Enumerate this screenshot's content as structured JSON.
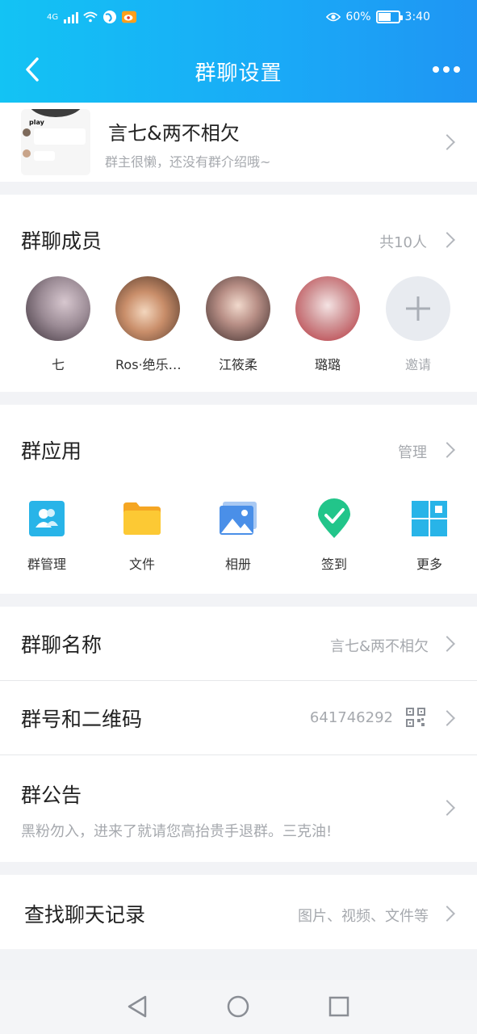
{
  "status_bar": {
    "network_label": "4G",
    "battery": "60%",
    "time": "3:40"
  },
  "nav": {
    "title": "群聊设置"
  },
  "group": {
    "name": "言七&两不相欠",
    "description": "群主很懒，还没有群介绍哦~",
    "thumb_label": "play"
  },
  "members": {
    "title": "群聊成员",
    "count": "共10人",
    "list": [
      {
        "name": "七"
      },
      {
        "name": "Ros·绝乐…"
      },
      {
        "name": "江筱柔"
      },
      {
        "name": "璐璐"
      }
    ],
    "invite_label": "邀请"
  },
  "apps": {
    "title": "群应用",
    "manage": "管理",
    "items": [
      {
        "label": "群管理",
        "icon": "group-manage-icon"
      },
      {
        "label": "文件",
        "icon": "folder-icon"
      },
      {
        "label": "相册",
        "icon": "photo-album-icon"
      },
      {
        "label": "签到",
        "icon": "check-in-icon"
      },
      {
        "label": "更多",
        "icon": "more-grid-icon"
      }
    ]
  },
  "settings": {
    "group_name_label": "群聊名称",
    "group_name_value": "言七&两不相欠",
    "group_id_label": "群号和二维码",
    "group_id_value": "641746292",
    "notice_label": "群公告",
    "notice_value": "黑粉勿入，进来了就请您高抬贵手退群。三克油!"
  },
  "search": {
    "label": "查找聊天记录",
    "hint": "图片、视频、文件等"
  },
  "colors": {
    "header_start": "#13c3f4",
    "header_end": "#1f95f3",
    "accent_green": "#22c58a",
    "folder_yellow": "#fbc02d"
  }
}
